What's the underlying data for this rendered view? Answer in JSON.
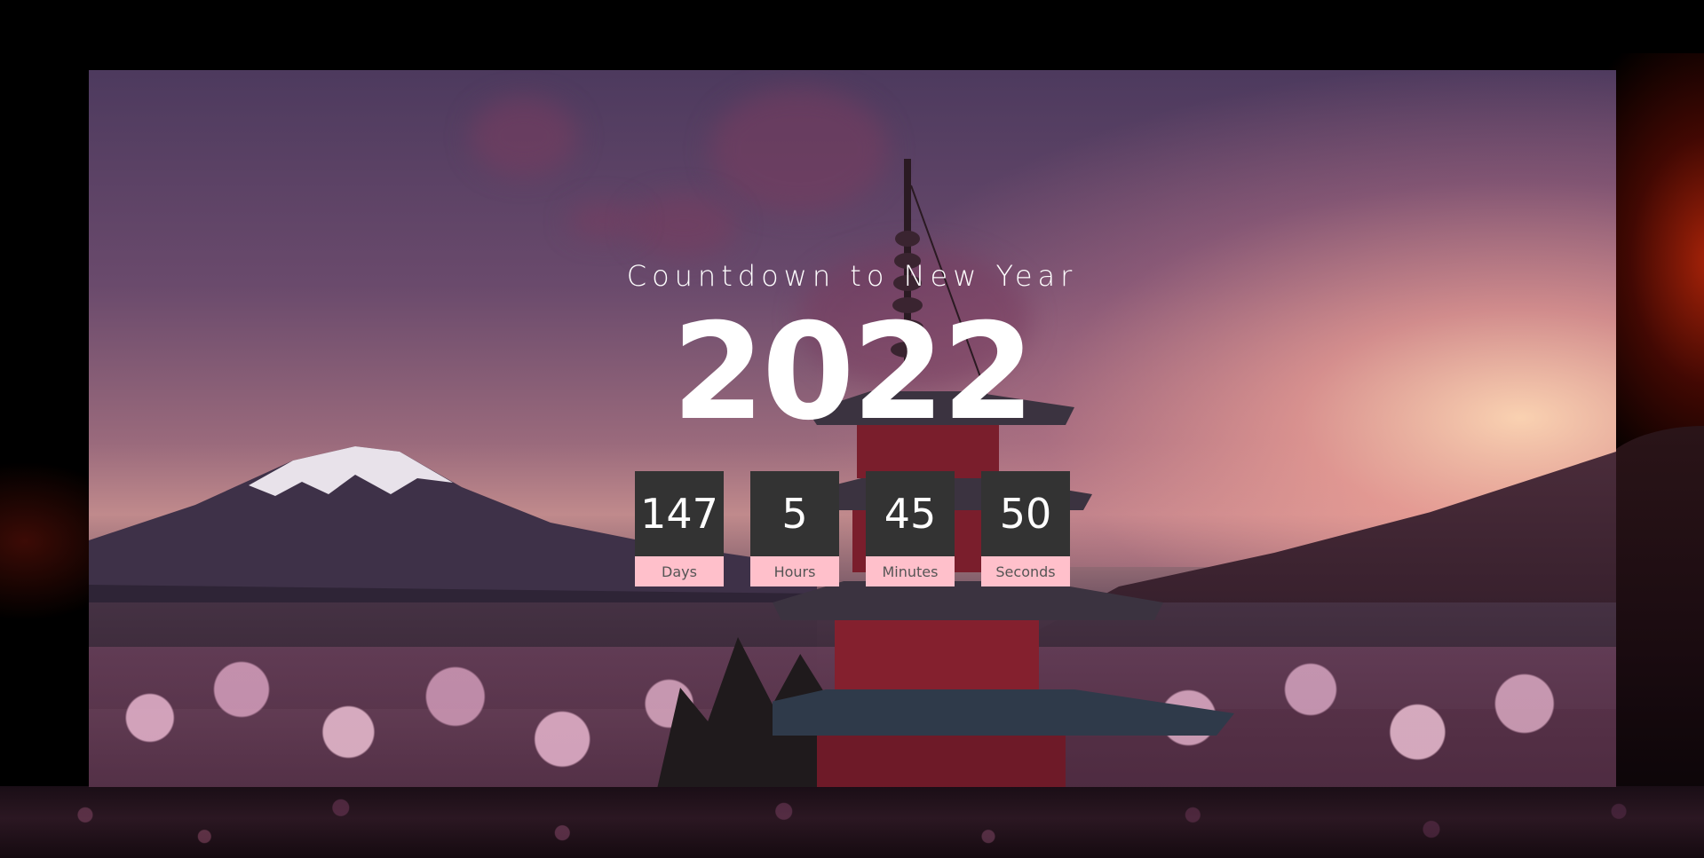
{
  "countdown_page": {
    "subtitle": "Countdown to New Year",
    "year": "2022",
    "units": [
      {
        "value": "147",
        "label": "Days"
      },
      {
        "value": "5",
        "label": "Hours"
      },
      {
        "value": "45",
        "label": "Minutes"
      },
      {
        "value": "50",
        "label": "Seconds"
      }
    ]
  },
  "colors": {
    "page_background": "#000000",
    "number_box": "#333333",
    "label_box": "#ffc0cb",
    "text": "#ffffff"
  }
}
